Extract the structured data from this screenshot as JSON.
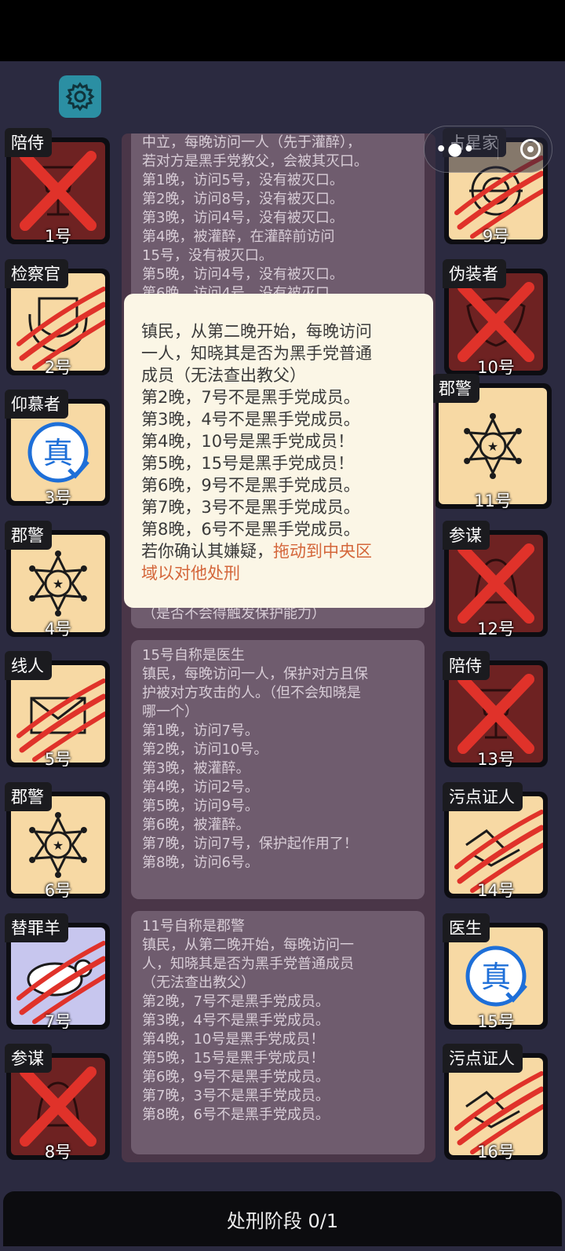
{
  "settings_icon": "gear-icon",
  "capsule": {
    "menu_icon": "more-dots-icon",
    "close_icon": "target-icon"
  },
  "players": [
    {
      "num": "1号",
      "role": "陪侍",
      "status": "dead",
      "icon": "wine-glass-icon"
    },
    {
      "num": "2号",
      "role": "检察官",
      "status": "clawed",
      "icon": "laurel-badge-icon"
    },
    {
      "num": "3号",
      "role": "仰慕者",
      "status": "verified",
      "icon": "true-seal-icon"
    },
    {
      "num": "4号",
      "role": "郡警",
      "status": "alive",
      "icon": "sheriff-star-icon"
    },
    {
      "num": "5号",
      "role": "线人",
      "status": "clawed",
      "icon": "envelope-icon"
    },
    {
      "num": "6号",
      "role": "郡警",
      "status": "alive",
      "icon": "sheriff-star-icon"
    },
    {
      "num": "7号",
      "role": "替罪羊",
      "status": "clawed",
      "icon": "sheep-icon"
    },
    {
      "num": "8号",
      "role": "参谋",
      "status": "dead",
      "icon": "bell-icon"
    },
    {
      "num": "9号",
      "role": "占星家",
      "status": "clawed",
      "icon": "astrolabe-icon"
    },
    {
      "num": "10号",
      "role": "伪装者",
      "status": "dead",
      "icon": "mask-icon"
    },
    {
      "num": "11号",
      "role": "郡警",
      "status": "selected",
      "icon": "sheriff-star-icon"
    },
    {
      "num": "12号",
      "role": "参谋",
      "status": "dead",
      "icon": "bell-icon"
    },
    {
      "num": "13号",
      "role": "陪侍",
      "status": "dead",
      "icon": "wine-glass-icon"
    },
    {
      "num": "14号",
      "role": "污点证人",
      "status": "clawed",
      "icon": "handshake-icon"
    },
    {
      "num": "15号",
      "role": "医生",
      "status": "verified",
      "icon": "true-seal-icon"
    },
    {
      "num": "16号",
      "role": "污点证人",
      "status": "clawed",
      "icon": "handshake-icon"
    }
  ],
  "log": {
    "msg1": [
      "中立，每晚访问一人（先于灌醉），",
      "若对方是黑手党教父，会被其灭口。",
      "第1晚，访问5号，没有被灭口。",
      "第2晚，访问8号，没有被灭口。",
      "第3晚，访问4号，没有被灭口。",
      "第4晚，被灌醉，在灌醉前访问",
      "15号，没有被灭口。",
      "第5晚，访问4号，没有被灭口。",
      "第6晚，访问4号，没有被灭口。"
    ],
    "msg2_tail": "（是否不会得触发保护能力）",
    "msg3": [
      "15号自称是医生",
      "镇民，每晚访问一人，保护对方且保",
      "护被对方攻击的人。（但不会知晓是",
      "哪一个）",
      "第1晚，访问7号。",
      "第2晚，访问10号。",
      "第3晚，被灌醉。",
      "第4晚，访问2号。",
      "第5晚，访问9号。",
      "第6晚，被灌醉。",
      "第7晚，访问7号，保护起作用了！",
      "第8晚，访问6号。"
    ],
    "msg4": [
      "11号自称是郡警",
      "镇民，从第二晚开始，每晚访问一",
      "人，知晓其是否为黑手党普通成员",
      "（无法查出教父）",
      "第2晚，7号不是黑手党成员。",
      "第3晚，4号不是黑手党成员。",
      "第4晚，10号是黑手党成员！",
      "第5晚，15号是黑手党成员！",
      "第6晚，9号不是黑手党成员。",
      "第7晚，3号不是黑手党成员。",
      "第8晚，6号不是黑手党成员。"
    ]
  },
  "popup": {
    "lines": [
      "镇民，从第二晚开始，每晚访问",
      "一人，知晓其是否为黑手党普通",
      "成员（无法查出教父）",
      "第2晚，7号不是黑手党成员。",
      "第3晚，4号不是黑手党成员。",
      "第4晚，10号是黑手党成员！",
      "第5晚，15号是黑手党成员！",
      "第6晚，9号不是黑手党成员。",
      "第7晚，3号不是黑手党成员。",
      "第8晚，6号不是黑手党成员。"
    ],
    "hint_prefix": "若你确认其嫌疑，",
    "hint_action1": "拖动到中央区",
    "hint_action2": "域以对他处刑"
  },
  "phase": {
    "label": "处刑阶段 0/1"
  },
  "colors": {
    "card_bg": "#f7d9a4",
    "dead_bg": "#6e2222",
    "claw": "#e0322a",
    "seal": "#1e6fd8",
    "popup_highlight": "#d4663a"
  }
}
